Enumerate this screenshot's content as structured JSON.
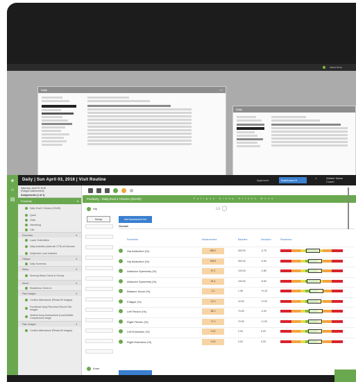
{
  "app": {
    "title": "Daily | Sun April 03, 2016 | Visit Routine",
    "brand_icon": "plus-icon",
    "accent_color": "#6aa84f",
    "link": "Approved",
    "dropdown_value": "Dashboard",
    "user_name": "Athlete Name",
    "user_role": "Coach"
  },
  "sidebar": {
    "date_line": "Saturday, April 02 2016",
    "date_sub": "(Fatigue assessment)",
    "assignment_label": "Assignments (1 of 1)",
    "section": "Positivity",
    "items": [
      {
        "label": "Daily Eval 2 Checks (SOAR)",
        "type": "item",
        "tall": true
      },
      {
        "label": "Quad",
        "type": "item"
      },
      {
        "label": "Glute",
        "type": "item"
      },
      {
        "label": "Hamstring",
        "type": "item"
      },
      {
        "label": "Calf",
        "type": "item"
      },
      {
        "label": "Exercises",
        "type": "group"
      },
      {
        "label": "Lower Extremities",
        "type": "item"
      },
      {
        "label": "Daily Activities (Internal/ CTR) at Exercise",
        "type": "item",
        "tall": true
      },
      {
        "label": "Subjective Load Indicator",
        "type": "item"
      },
      {
        "label": "Fatigue",
        "type": "group"
      },
      {
        "label": "Daily Soreness",
        "type": "item"
      },
      {
        "label": "Sleep",
        "type": "group"
      },
      {
        "label": "Morning Sleep Check-In Survey",
        "type": "item",
        "tall": true
      },
      {
        "label": "Mood",
        "type": "group"
      },
      {
        "label": "Readiness Check-In",
        "type": "item"
      },
      {
        "label": "Pain Images",
        "type": "group"
      },
      {
        "label": "Confirm Attendance (Please fill images)",
        "type": "item",
        "tall": true
      },
      {
        "label": "Functional Injury Recovery Record Tab Images",
        "type": "item",
        "tall": true
      },
      {
        "label": "Vertical Jump Assessment (Load Athlete Comparison) Image",
        "type": "item",
        "tall": true
      },
      {
        "label": "Pain Images",
        "type": "group"
      },
      {
        "label": "Confirm Attendance (Please fill images)",
        "type": "item",
        "tall": true
      }
    ]
  },
  "content": {
    "band_title": "Positivity - Daily Eval 2 Checks (SOAR)",
    "band_sub": "Fatigue Sleep Stress Mood",
    "subhead_label": "Hip",
    "setup_button": "Setup",
    "action_button": "Add Assessment Set",
    "section_title": "Overall",
    "columns": [
      "Parameter",
      "Measurement",
      "Baseline",
      "Deviation",
      "Readiness"
    ],
    "rows": [
      {
        "label": "Hip Adduction (%)",
        "value": "385.0",
        "n1": "400.00",
        "n2": "-3.75",
        "mark": 0.52
      },
      {
        "label": "Hip Abduction (%)",
        "value": "298.5",
        "n1": "300.00",
        "n2": "-0.50",
        "mark": 0.56
      },
      {
        "label": "Adductor Symmetry (%)",
        "value": "97.2",
        "n1": "100.00",
        "n2": "-2.80",
        "mark": 0.55
      },
      {
        "label": "Abductor Symmetry (%)",
        "value": "94.4",
        "n1": "100.00",
        "n2": "-5.60",
        "mark": 0.53
      },
      {
        "label": "Balance Score (%)",
        "value": "2.1",
        "n1": "1.95",
        "n2": "+0.15",
        "mark": 0.58
      },
      {
        "label": "Fatigue (%)",
        "value": "12.0",
        "n1": "10.00",
        "n2": "+2.00",
        "mark": 0.54
      },
      {
        "label": "Left Flexion (%)",
        "value": "68.0",
        "n1": "70.00",
        "n2": "-2.00",
        "mark": 0.57
      },
      {
        "label": "Right Flexion (%)",
        "value": "71.0",
        "n1": "70.00",
        "n2": "+1.00",
        "mark": 0.55
      },
      {
        "label": "Left Extension (%)",
        "value": "0.00",
        "n1": "0.00",
        "n2": "0.00",
        "mark": 0.55
      },
      {
        "label": "Right Extension (%)",
        "value": "0.00",
        "n1": "0.00",
        "n2": "0.00",
        "mark": 0.55
      }
    ],
    "footer_label": "Knee"
  },
  "back_panels": {
    "left_title": "Daily",
    "right_title": "Daily"
  }
}
